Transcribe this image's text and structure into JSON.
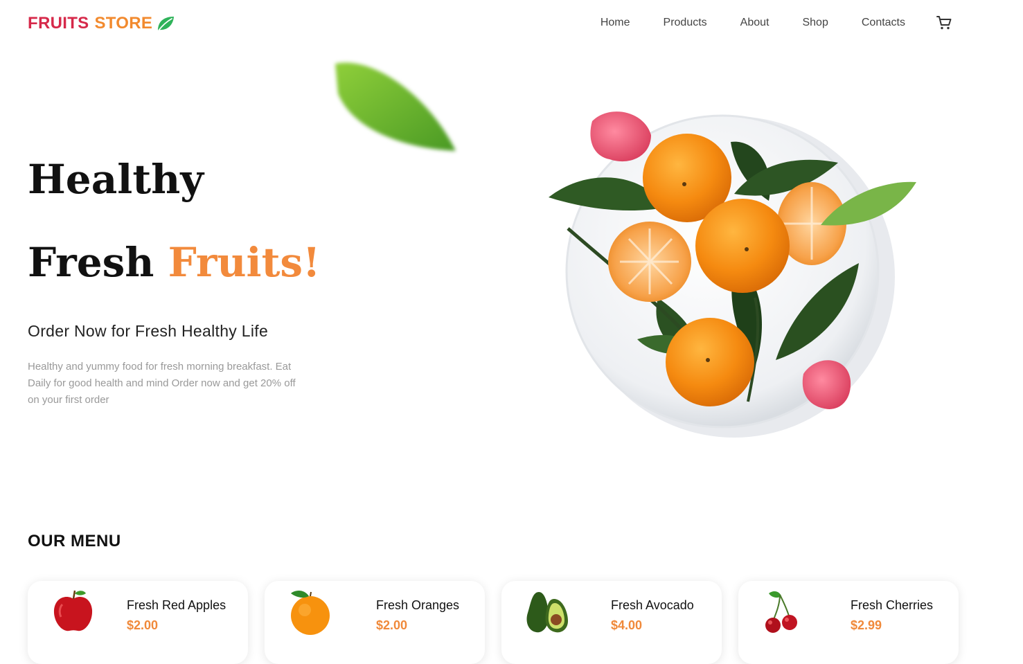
{
  "brand": {
    "word1": "FRUITS",
    "word2": "STORE",
    "icon": "leaf-icon",
    "color1": "#d6294a",
    "color2": "#f28a2e"
  },
  "nav": {
    "items": [
      {
        "label": "Home"
      },
      {
        "label": "Products"
      },
      {
        "label": "About"
      },
      {
        "label": "Shop"
      },
      {
        "label": "Contacts"
      }
    ],
    "cart_icon": "cart-icon"
  },
  "hero": {
    "line1": "Healthy",
    "line2_a": "Fresh",
    "line2_b": "Fruits!",
    "accent_color": "#f28a3c",
    "subtitle": "Order Now for Fresh Healthy Life",
    "description": "Healthy and yummy food for fresh morning breakfast. Eat Daily for good health and mind Order now and get 20% off on your first order"
  },
  "menu": {
    "title": "OUR MENU",
    "items": [
      {
        "name": "Fresh Red Apples",
        "price": "$2.00",
        "icon": "apple-icon"
      },
      {
        "name": "Fresh Oranges",
        "price": "$2.00",
        "icon": "orange-icon"
      },
      {
        "name": "Fresh Avocado",
        "price": "$4.00",
        "icon": "avocado-icon"
      },
      {
        "name": "Fresh Cherries",
        "price": "$2.99",
        "icon": "cherries-icon"
      }
    ],
    "price_color": "#f0893a"
  }
}
